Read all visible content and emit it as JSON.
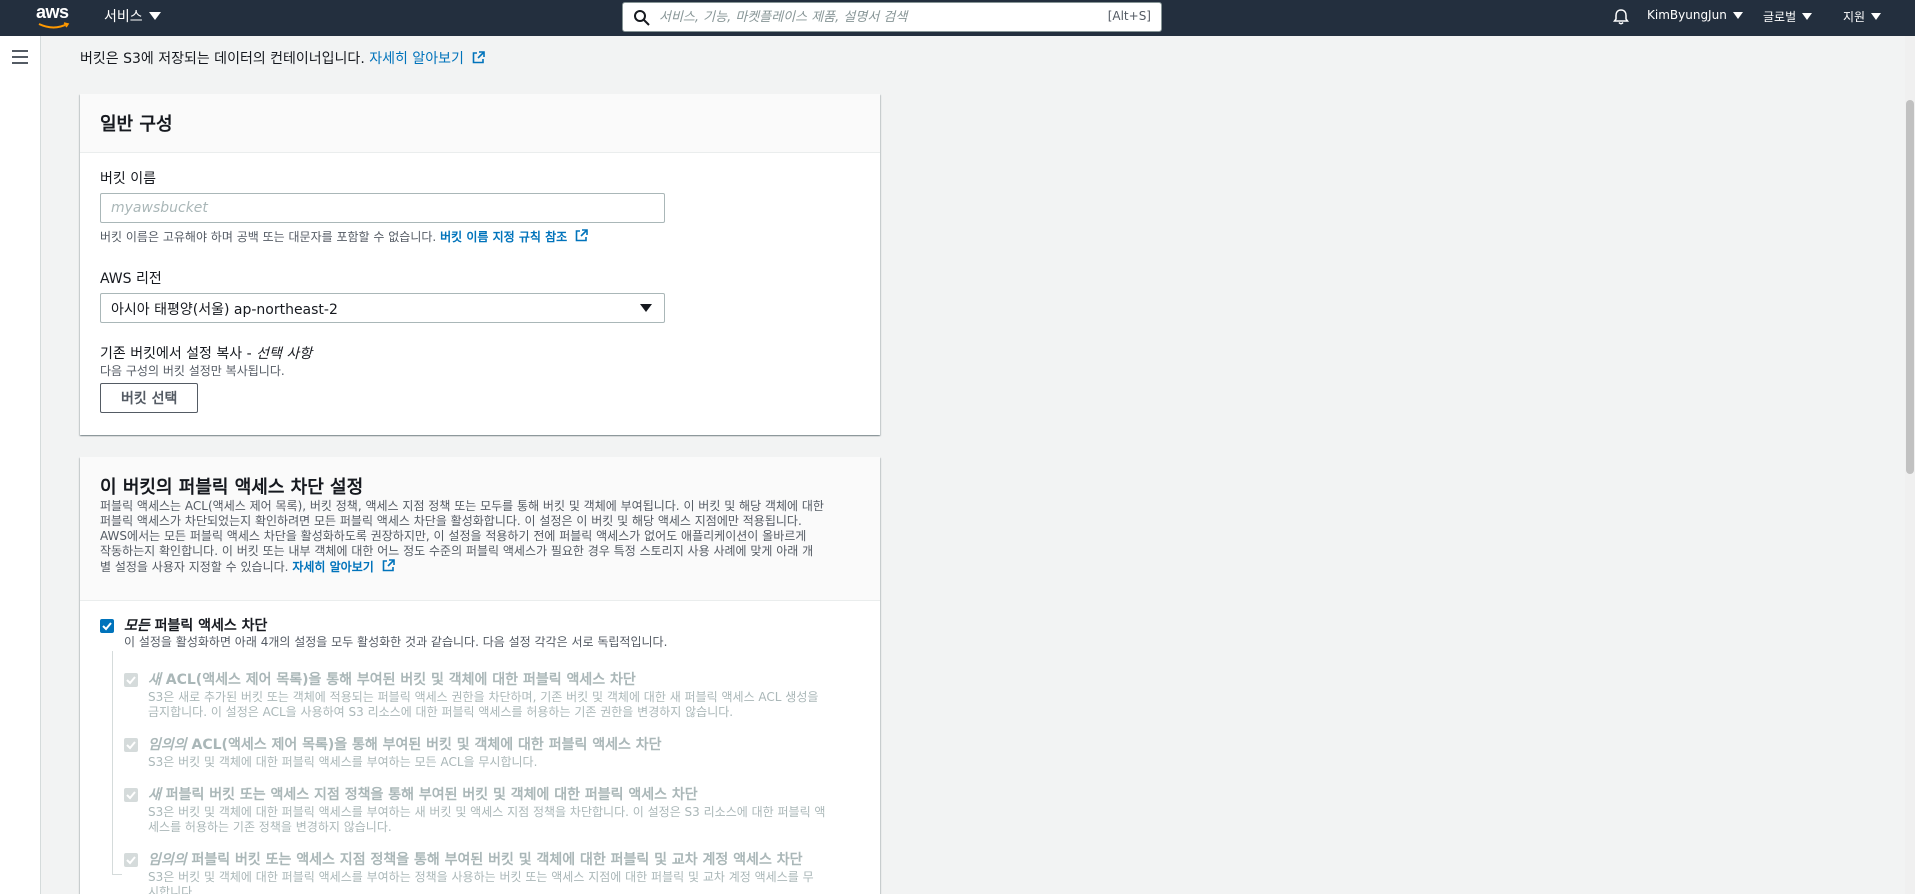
{
  "topnav": {
    "logo_text": "aws",
    "services_label": "서비스",
    "search_placeholder": "서비스, 기능, 마켓플레이스 제품, 설명서 검색",
    "search_shortcut": "[Alt+S]",
    "user_label": "KimByungJun",
    "region_label": "글로벌",
    "support_label": "지원"
  },
  "intro": {
    "text": "버킷은 S3에 저장되는 데이터의 컨테이너입니다.",
    "link": "자세히 알아보기"
  },
  "general": {
    "title": "일반 구성",
    "bucket_name_label": "버킷 이름",
    "bucket_name_value": "",
    "bucket_name_placeholder": "myawsbucket",
    "bucket_name_hint": "버킷 이름은 고유해야 하며 공백 또는 대문자를 포함할 수 없습니다.",
    "bucket_name_rule_link": "버킷 이름 지정 규칙 참조",
    "region_label": "AWS 리전",
    "region_value": "아시아 태평양(서울) ap-northeast-2",
    "copy_label": "기존 버킷에서 설정 복사 -",
    "copy_optional": "선택 사항",
    "copy_hint": "다음 구성의 버킷 설정만 복사됩니다.",
    "choose_bucket_button": "버킷 선택"
  },
  "public_access": {
    "title": "이 버킷의 퍼블릭 액세스 차단 설정",
    "description_lines": [
      "퍼블릭 액세스는 ACL(액세스 제어 목록), 버킷 정책, 액세스 지점 정책 또는 모두를 통해 버킷 및 객체에 부여됩니다. 이 버킷 및 해당 객체에 대한",
      "퍼블릭 액세스가 차단되었는지 확인하려면 모든 퍼블릭 액세스 차단을 활성화합니다. 이 설정은 이 버킷 및 해당 액세스 지점에만 적용됩니다.",
      "AWS에서는 모든 퍼블릭 액세스 차단을 활성화하도록 권장하지만, 이 설정을 적용하기 전에 퍼블릭 액세스가 없어도 애플리케이션이 올바르게",
      "작동하는지 확인합니다. 이 버킷 또는 내부 객체에 대한 어느 정도 수준의 퍼블릭 액세스가 필요한 경우 특정 스토리지 사용 사례에 맞게 아래 개",
      "별 설정을 사용자 지정할 수 있습니다."
    ],
    "learn_more_link": "자세히 알아보기",
    "block_all": {
      "title_em": "모든",
      "title_rest": "퍼블릭 액세스 차단",
      "checked": true,
      "desc": "이 설정을 활성화하면 아래 4개의 설정을 모두 활성화한 것과 같습니다. 다음 설정 각각은 서로 독립적입니다."
    },
    "options": [
      {
        "title_em": "새",
        "title_rest": "ACL(액세스 제어 목록)을 통해 부여된 버킷 및 객체에 대한 퍼블릭 액세스 차단",
        "desc_lines": [
          "S3은 새로 추가된 버킷 또는 객체에 적용되는 퍼블릭 액세스 권한을 차단하며, 기존 버킷 및 객체에 대한 새 퍼블릭 액세스 ACL 생성을",
          "금지합니다. 이 설정은 ACL을 사용하여 S3 리소스에 대한 퍼블릭 액세스를 허용하는 기존 권한을 변경하지 않습니다."
        ]
      },
      {
        "title_em": "임의의",
        "title_rest": "ACL(액세스 제어 목록)을 통해 부여된 버킷 및 객체에 대한 퍼블릭 액세스 차단",
        "desc_lines": [
          "S3은 버킷 및 객체에 대한 퍼블릭 액세스를 부여하는 모든 ACL을 무시합니다."
        ]
      },
      {
        "title_em": "새",
        "title_rest": "퍼블릭 버킷 또는 액세스 지점 정책을 통해 부여된 버킷 및 객체에 대한 퍼블릭 액세스 차단",
        "desc_lines": [
          "S3은 버킷 및 객체에 대한 퍼블릭 액세스를 부여하는 새 버킷 및 액세스 지점 정책을 차단합니다. 이 설정은 S3 리소스에 대한 퍼블릭 액",
          "세스를 허용하는 기존 정책을 변경하지 않습니다."
        ]
      },
      {
        "title_em": "임의의",
        "title_rest": "퍼블릭 버킷 또는 액세스 지점 정책을 통해 부여된 버킷 및 객체에 대한 퍼블릭 및 교차 계정 액세스 차단",
        "desc_lines": [
          "S3은 버킷 및 객체에 대한 퍼블릭 액세스를 부여하는 정책을 사용하는 버킷 또는 액세스 지점에 대한 퍼블릭 및 교차 계정 액세스를 무",
          "시합니다."
        ]
      }
    ]
  }
}
